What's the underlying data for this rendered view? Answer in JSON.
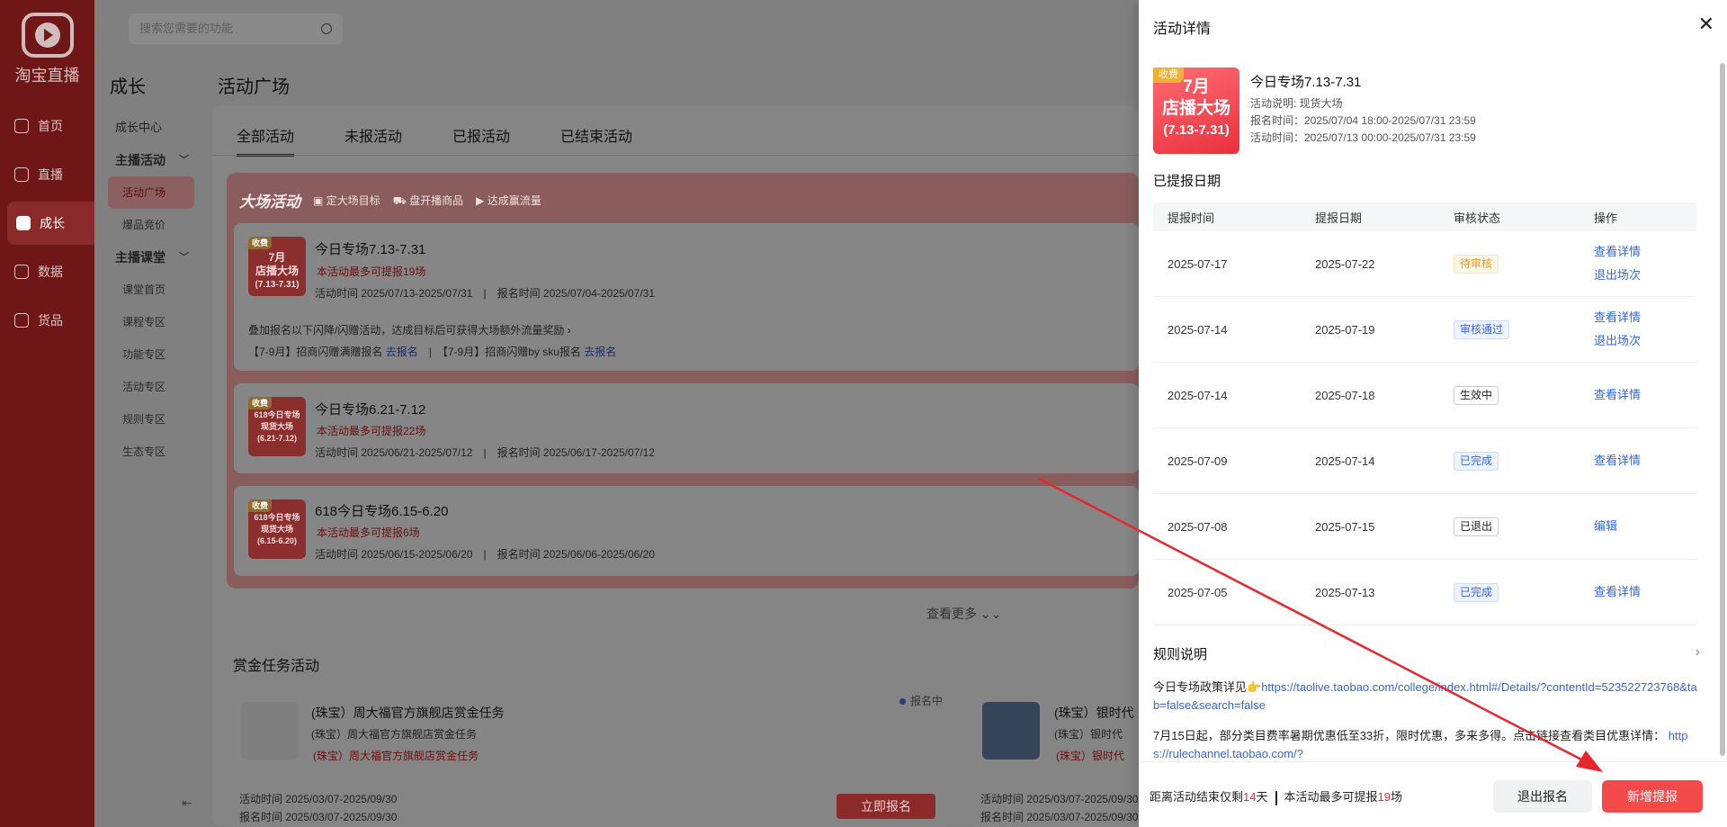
{
  "nav": {
    "logo_text": "淘宝直播",
    "items": [
      {
        "label": "首页"
      },
      {
        "label": "直播"
      },
      {
        "label": "成长"
      },
      {
        "label": "数据"
      },
      {
        "label": "货品"
      }
    ]
  },
  "search": {
    "placeholder": "搜索您需要的功能"
  },
  "sub": {
    "title": "成长",
    "center": "成长中心",
    "group1": "主播活动",
    "g1_items": [
      "活动广场",
      "爆品竞价"
    ],
    "group2": "主播课堂",
    "g2_items": [
      "课堂首页",
      "课程专区",
      "功能专区",
      "活动专区",
      "规则专区",
      "生态专区"
    ]
  },
  "main": {
    "title": "活动广场",
    "tabs": [
      "全部活动",
      "未报活动",
      "已报活动",
      "已结束活动"
    ],
    "banner": {
      "brand": "大场活动",
      "features": [
        "定大场目标",
        "盘开播商品",
        "达成赢流量"
      ]
    },
    "activities": [
      {
        "thumb_tag": "收费",
        "thumb_l1": "7月",
        "thumb_l2": "店播大场",
        "thumb_l3": "(7.13-7.31)",
        "title": "今日专场7.13-7.31",
        "limit": "本活动最多可提报19场",
        "act_time": "活动时间 2025/07/13-2025/07/31",
        "reg_time": "报名时间 2025/07/04-2025/07/31",
        "extra": "叠加报名以下闪降/闪赠活动，达成目标后可获得大场额外流量奖励",
        "links": [
          {
            "text": "【7-9月】招商闪赠满赠报名",
            "link": "去报名"
          },
          {
            "text": "【7-9月】招商闪赠by sku报名",
            "link": "去报名"
          }
        ]
      },
      {
        "thumb_tag": "收费",
        "thumb_l1": "618今日专场",
        "thumb_l2": "现货大场",
        "thumb_l3": "(6.21-7.12)",
        "title": "今日专场6.21-7.12",
        "limit": "本活动最多可提报22场",
        "act_time": "活动时间 2025/06/21-2025/07/12",
        "reg_time": "报名时间 2025/06/17-2025/07/12"
      },
      {
        "thumb_tag": "收费",
        "thumb_l1": "618今日专场",
        "thumb_l2": "现货大场",
        "thumb_l3": "(6.15-6.20)",
        "title": "618今日专场6.15-6.20",
        "limit": "本活动最多可提报6场",
        "act_time": "活动时间 2025/06/15-2025/06/20",
        "reg_time": "报名时间 2025/06/06-2025/06/20"
      }
    ],
    "more": "查看更多",
    "bounty_title": "赏金任务活动",
    "bounties": [
      {
        "name": "(珠宝）周大福官方旗舰店赏金任务",
        "sub": "(珠宝）周大福官方旗舰店赏金任务",
        "red": "(珠宝）周大福官方旗舰店赏金任务",
        "status": "报名中",
        "act_time": "活动时间 2025/03/07-2025/09/30",
        "reg_time": "报名时间 2025/03/07-2025/09/30",
        "button": "立即报名"
      },
      {
        "name": "(珠宝）银时代",
        "sub": "(珠宝）银时代",
        "red": "(珠宝）银时代",
        "act_time": "活动时间 2025/03/07-2025/09/30",
        "reg_time": "报名时间 2025/03/07-2025/09/30"
      }
    ]
  },
  "drawer": {
    "title": "活动详情",
    "thumb": {
      "tag": "收费",
      "l1": "7月",
      "l2": "店播大场",
      "l3": "(7.13-7.31)"
    },
    "name": "今日专场7.13-7.31",
    "desc": "活动说明: 现货大场",
    "reg": "报名时间：2025/07/04 18:00-2025/07/31 23:59",
    "act": "活动时间：2025/07/13 00:00-2025/07/31 23:59",
    "section_dates": "已提报日期",
    "headers": [
      "提报时间",
      "提报日期",
      "审核状态",
      "操作"
    ],
    "rows": [
      {
        "submit": "2025-07-17",
        "date": "2025-07-22",
        "status": "待审核",
        "ops": [
          "查看详情",
          "退出场次"
        ]
      },
      {
        "submit": "2025-07-14",
        "date": "2025-07-19",
        "status": "审核通过",
        "ops": [
          "查看详情",
          "退出场次"
        ]
      },
      {
        "submit": "2025-07-14",
        "date": "2025-07-18",
        "status": "生效中",
        "ops": [
          "查看详情"
        ]
      },
      {
        "submit": "2025-07-09",
        "date": "2025-07-14",
        "status": "已完成",
        "ops": [
          "查看详情"
        ]
      },
      {
        "submit": "2025-07-08",
        "date": "2025-07-15",
        "status": "已退出",
        "ops": [
          "编辑"
        ]
      },
      {
        "submit": "2025-07-05",
        "date": "2025-07-13",
        "status": "已完成",
        "ops": [
          "查看详情"
        ]
      }
    ],
    "section_rules": "规则说明",
    "rule1_prefix": "今日专场政策详见👉",
    "rule1_link": "https://taolive.taobao.com/college/index.html#/Details/?contentId=523522723768&tab=false&search=false",
    "rule2_prefix": "7月15日起，部分类目费率暑期优惠低至33折，限时优惠，多来多得。点击链接查看类目优惠详情：",
    "rule2_link": "https://rulechannel.taobao.com/?",
    "footer": {
      "countdown_pre": "距离活动结束仅剩",
      "days": "14",
      "countdown_post": "天",
      "limit_pre": "本活动最多可提报",
      "limit_num": "19",
      "limit_post": "场",
      "quit_btn": "退出报名",
      "add_btn": "新增提报"
    }
  },
  "colors": {
    "accent": "#f44a4a",
    "link": "#3366e0",
    "pending": "#f0961a"
  }
}
